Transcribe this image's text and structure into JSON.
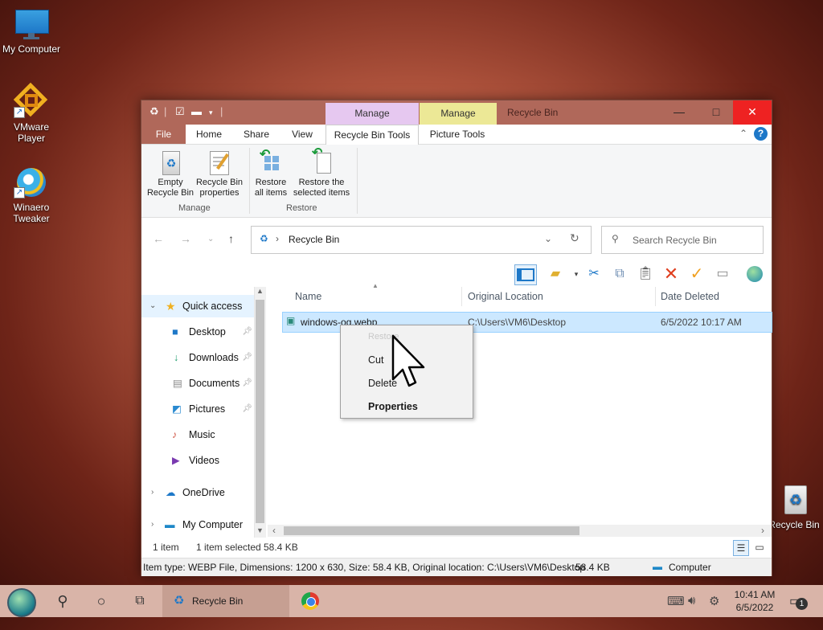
{
  "desktop": {
    "icons": [
      {
        "label": "My Computer"
      },
      {
        "label": "VMware Player"
      },
      {
        "label": "Winaero Tweaker"
      },
      {
        "label": "Recycle Bin"
      }
    ]
  },
  "window": {
    "title": "Recycle Bin",
    "context_tabs": {
      "manage1": "Manage",
      "manage2": "Manage"
    },
    "caption": {
      "minimize": "—",
      "maximize": "□",
      "close": "✕"
    },
    "tabs": {
      "file": "File",
      "home": "Home",
      "share": "Share",
      "view": "View",
      "recycle_tools": "Recycle Bin Tools",
      "picture_tools": "Picture Tools"
    },
    "ribbon": {
      "empty_l1": "Empty",
      "empty_l2": "Recycle Bin",
      "props_l1": "Recycle Bin",
      "props_l2": "properties",
      "restore_all_l1": "Restore",
      "restore_all_l2": "all items",
      "restore_sel_l1": "Restore the",
      "restore_sel_l2": "selected items",
      "group_manage": "Manage",
      "group_restore": "Restore"
    },
    "address": {
      "path": "Recycle Bin",
      "search_placeholder": "Search Recycle Bin"
    },
    "nav": {
      "quick_access": "Quick access",
      "desktop": "Desktop",
      "downloads": "Downloads",
      "documents": "Documents",
      "pictures": "Pictures",
      "music": "Music",
      "videos": "Videos",
      "onedrive": "OneDrive",
      "my_computer": "My Computer"
    },
    "columns": {
      "name": "Name",
      "original_location": "Original Location",
      "date_deleted": "Date Deleted"
    },
    "files": [
      {
        "name": "windows-og.webp",
        "original_location": "C:\\Users\\VM6\\Desktop",
        "date_deleted": "6/5/2022 10:17 AM"
      }
    ],
    "context_menu": {
      "restore": "Restore",
      "cut": "Cut",
      "delete": "Delete",
      "properties": "Properties"
    },
    "status": {
      "count": "1 item",
      "selected": "1 item selected",
      "size": "58.4 KB"
    },
    "details": {
      "info": "Item type: WEBP File, Dimensions: 1200 x 630, Size: 58.4 KB, Original location: C:\\Users\\VM6\\Desktop",
      "size": "58.4 KB",
      "location": "Computer"
    }
  },
  "taskbar": {
    "app_label": "Recycle Bin",
    "time": "10:41 AM",
    "date": "6/5/2022",
    "notif_count": "1"
  },
  "colors": {
    "accent": "#b0685a",
    "manage1": "#e6c8f0",
    "manage2": "#ece896",
    "selection": "#cce8ff"
  }
}
